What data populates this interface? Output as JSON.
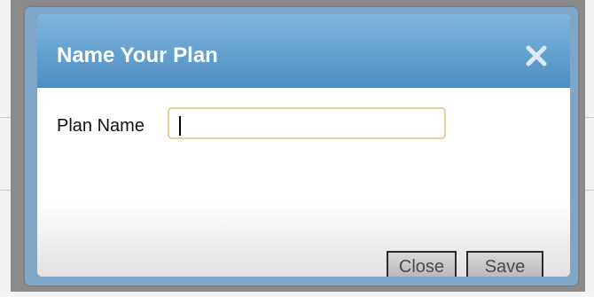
{
  "dialog": {
    "title": "Name Your Plan",
    "close_icon": "close-x-icon",
    "header_color": "#5f9ccc"
  },
  "form": {
    "plan_name_label": "Plan Name",
    "plan_name_value": "",
    "plan_name_placeholder": ""
  },
  "buttons": {
    "close_label": "Close",
    "save_label": "Save"
  }
}
